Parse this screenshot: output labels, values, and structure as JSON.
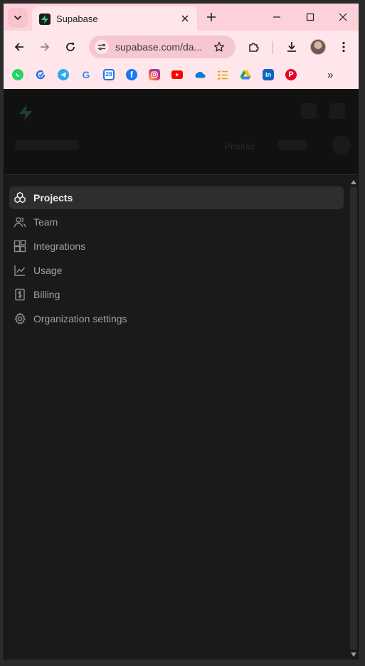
{
  "browser": {
    "tab": {
      "title": "Supabase"
    },
    "address_bar": {
      "url": "supabase.com/da..."
    },
    "bookmarks": [
      {
        "name": "whatsapp",
        "color": "#25d366"
      },
      {
        "name": "refresh-app",
        "color": "#1a73e8"
      },
      {
        "name": "telegram",
        "color": "#2aabee"
      },
      {
        "name": "google",
        "color": "#ffffff"
      },
      {
        "name": "calendar",
        "color": "#1a73e8",
        "glyph": "28"
      },
      {
        "name": "facebook",
        "color": "#1877f2"
      },
      {
        "name": "instagram",
        "color": "#e1306c"
      },
      {
        "name": "youtube",
        "color": "#ff0000"
      },
      {
        "name": "onedrive",
        "color": "#0a78d4"
      },
      {
        "name": "tasks",
        "color": "#e0a400"
      },
      {
        "name": "drive",
        "color": "#1fa463"
      },
      {
        "name": "linkedin",
        "color": "#0a66c2"
      },
      {
        "name": "pinterest",
        "color": "#e60023"
      }
    ],
    "bookmarks_more": "»"
  },
  "page": {
    "header_product": "Product"
  },
  "menu": {
    "items": [
      {
        "label": "Projects",
        "icon": "boxes-icon",
        "active": true
      },
      {
        "label": "Team",
        "icon": "users-icon",
        "active": false
      },
      {
        "label": "Integrations",
        "icon": "blocks-icon",
        "active": false
      },
      {
        "label": "Usage",
        "icon": "chart-icon",
        "active": false
      },
      {
        "label": "Billing",
        "icon": "receipt-icon",
        "active": false
      },
      {
        "label": "Organization settings",
        "icon": "gear-icon",
        "active": false
      }
    ]
  },
  "colors": {
    "tabstrip": "#fdd1d9",
    "toolbar": "#ffe6ea",
    "panel": "#1a1a1a",
    "active_item": "#2e2e2e",
    "brand_green": "#3ecf8e"
  }
}
